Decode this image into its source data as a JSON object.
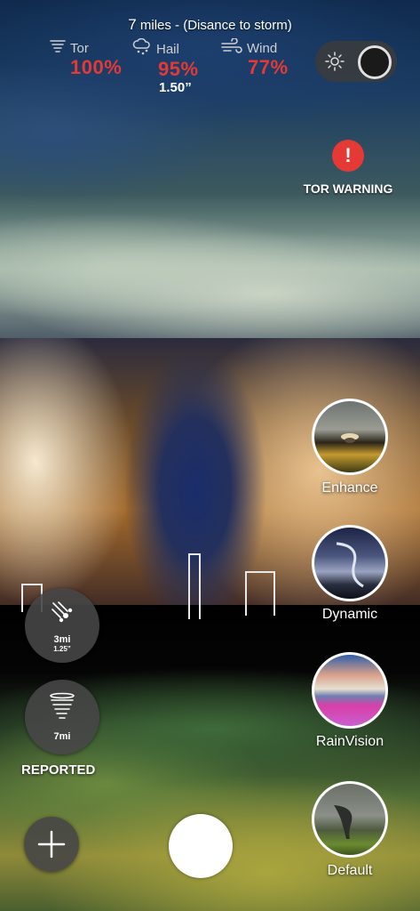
{
  "header": {
    "distance_number": "7",
    "distance_text": "miles - (Disance to storm)"
  },
  "stats": [
    {
      "label": "Tor",
      "value": "100%",
      "icon": "tornado-icon"
    },
    {
      "label": "Hail",
      "value": "95%",
      "sub": "1.50”",
      "icon": "hail-cloud-icon"
    },
    {
      "label": "Wind",
      "value": "77%",
      "icon": "wind-icon"
    }
  ],
  "toggle": {
    "icon": "sun-icon",
    "state": "off"
  },
  "warning": {
    "icon_text": "!",
    "label": "TOR WARNING"
  },
  "filters": [
    {
      "label": "Enhance"
    },
    {
      "label": "Dynamic"
    },
    {
      "label": "RainVision"
    },
    {
      "label": "Default"
    }
  ],
  "left_buttons": {
    "hail": {
      "icon": "hail-icon",
      "distance": "3mi",
      "size": "1.25”"
    },
    "tornado": {
      "icon": "tornado-icon",
      "distance": "7mi"
    },
    "reported_label": "REPORTED",
    "add": {
      "icon": "plus-icon"
    }
  },
  "colors": {
    "alert": "#e53935",
    "button_bg": "#464646"
  }
}
